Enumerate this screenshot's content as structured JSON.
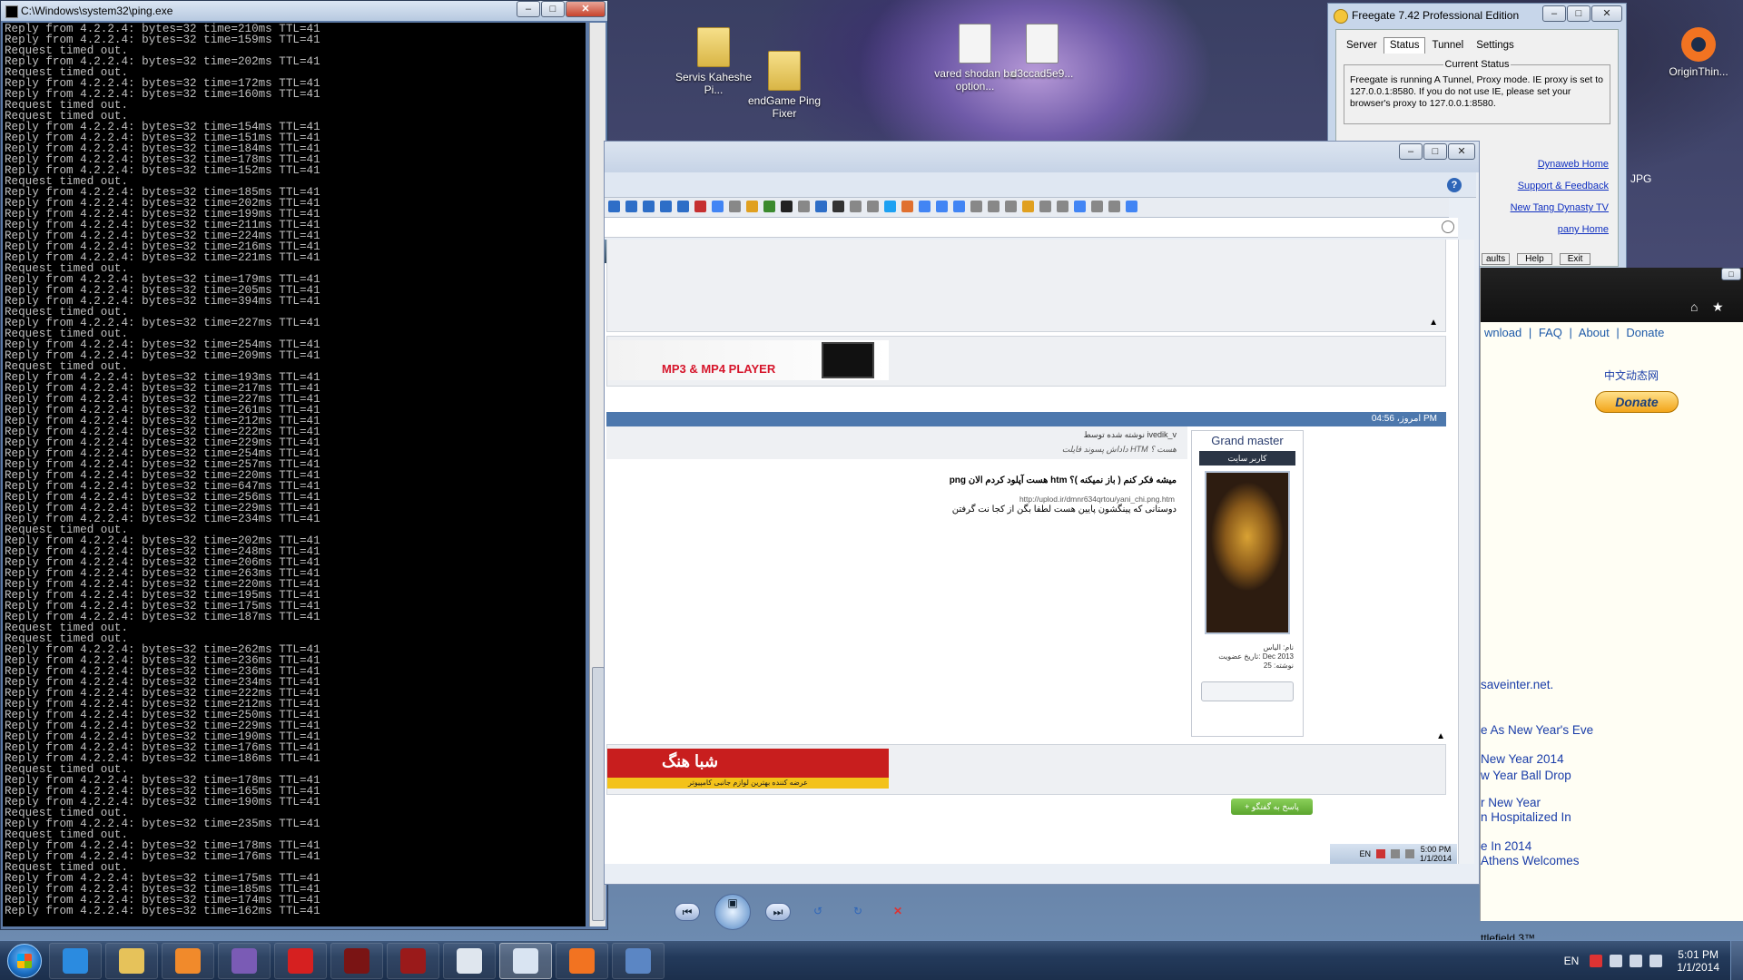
{
  "console": {
    "title": "C:\\Windows\\system32\\ping.exe",
    "lines": [
      "Reply from 4.2.2.4: bytes=32 time=210ms TTL=41",
      "Reply from 4.2.2.4: bytes=32 time=159ms TTL=41",
      "Request timed out.",
      "Reply from 4.2.2.4: bytes=32 time=202ms TTL=41",
      "Request timed out.",
      "Reply from 4.2.2.4: bytes=32 time=172ms TTL=41",
      "Reply from 4.2.2.4: bytes=32 time=160ms TTL=41",
      "Request timed out.",
      "Request timed out.",
      "Reply from 4.2.2.4: bytes=32 time=154ms TTL=41",
      "Reply from 4.2.2.4: bytes=32 time=151ms TTL=41",
      "Reply from 4.2.2.4: bytes=32 time=184ms TTL=41",
      "Reply from 4.2.2.4: bytes=32 time=178ms TTL=41",
      "Reply from 4.2.2.4: bytes=32 time=152ms TTL=41",
      "Request timed out.",
      "Reply from 4.2.2.4: bytes=32 time=185ms TTL=41",
      "Reply from 4.2.2.4: bytes=32 time=202ms TTL=41",
      "Reply from 4.2.2.4: bytes=32 time=199ms TTL=41",
      "Reply from 4.2.2.4: bytes=32 time=211ms TTL=41",
      "Reply from 4.2.2.4: bytes=32 time=224ms TTL=41",
      "Reply from 4.2.2.4: bytes=32 time=216ms TTL=41",
      "Reply from 4.2.2.4: bytes=32 time=221ms TTL=41",
      "Request timed out.",
      "Reply from 4.2.2.4: bytes=32 time=179ms TTL=41",
      "Reply from 4.2.2.4: bytes=32 time=205ms TTL=41",
      "Reply from 4.2.2.4: bytes=32 time=394ms TTL=41",
      "Request timed out.",
      "Reply from 4.2.2.4: bytes=32 time=227ms TTL=41",
      "Request timed out.",
      "Reply from 4.2.2.4: bytes=32 time=254ms TTL=41",
      "Reply from 4.2.2.4: bytes=32 time=209ms TTL=41",
      "Request timed out.",
      "Reply from 4.2.2.4: bytes=32 time=193ms TTL=41",
      "Reply from 4.2.2.4: bytes=32 time=217ms TTL=41",
      "Reply from 4.2.2.4: bytes=32 time=227ms TTL=41",
      "Reply from 4.2.2.4: bytes=32 time=261ms TTL=41",
      "Reply from 4.2.2.4: bytes=32 time=212ms TTL=41",
      "Reply from 4.2.2.4: bytes=32 time=222ms TTL=41",
      "Reply from 4.2.2.4: bytes=32 time=229ms TTL=41",
      "Reply from 4.2.2.4: bytes=32 time=254ms TTL=41",
      "Reply from 4.2.2.4: bytes=32 time=257ms TTL=41",
      "Reply from 4.2.2.4: bytes=32 time=220ms TTL=41",
      "Reply from 4.2.2.4: bytes=32 time=647ms TTL=41",
      "Reply from 4.2.2.4: bytes=32 time=256ms TTL=41",
      "Reply from 4.2.2.4: bytes=32 time=229ms TTL=41",
      "Reply from 4.2.2.4: bytes=32 time=234ms TTL=41",
      "Request timed out.",
      "Reply from 4.2.2.4: bytes=32 time=202ms TTL=41",
      "Reply from 4.2.2.4: bytes=32 time=248ms TTL=41",
      "Reply from 4.2.2.4: bytes=32 time=206ms TTL=41",
      "Reply from 4.2.2.4: bytes=32 time=263ms TTL=41",
      "Reply from 4.2.2.4: bytes=32 time=220ms TTL=41",
      "Reply from 4.2.2.4: bytes=32 time=195ms TTL=41",
      "Reply from 4.2.2.4: bytes=32 time=175ms TTL=41",
      "Reply from 4.2.2.4: bytes=32 time=187ms TTL=41",
      "Request timed out.",
      "Request timed out.",
      "Reply from 4.2.2.4: bytes=32 time=262ms TTL=41",
      "Reply from 4.2.2.4: bytes=32 time=236ms TTL=41",
      "Reply from 4.2.2.4: bytes=32 time=236ms TTL=41",
      "Reply from 4.2.2.4: bytes=32 time=234ms TTL=41",
      "Reply from 4.2.2.4: bytes=32 time=222ms TTL=41",
      "Reply from 4.2.2.4: bytes=32 time=212ms TTL=41",
      "Reply from 4.2.2.4: bytes=32 time=250ms TTL=41",
      "Reply from 4.2.2.4: bytes=32 time=229ms TTL=41",
      "Reply from 4.2.2.4: bytes=32 time=190ms TTL=41",
      "Reply from 4.2.2.4: bytes=32 time=176ms TTL=41",
      "Reply from 4.2.2.4: bytes=32 time=186ms TTL=41",
      "Request timed out.",
      "Reply from 4.2.2.4: bytes=32 time=178ms TTL=41",
      "Reply from 4.2.2.4: bytes=32 time=165ms TTL=41",
      "Reply from 4.2.2.4: bytes=32 time=190ms TTL=41",
      "Request timed out.",
      "Reply from 4.2.2.4: bytes=32 time=235ms TTL=41",
      "Request timed out.",
      "Reply from 4.2.2.4: bytes=32 time=178ms TTL=41",
      "Reply from 4.2.2.4: bytes=32 time=176ms TTL=41",
      "Request timed out.",
      "Reply from 4.2.2.4: bytes=32 time=175ms TTL=41",
      "Reply from 4.2.2.4: bytes=32 time=185ms TTL=41",
      "Reply from 4.2.2.4: bytes=32 time=174ms TTL=41",
      "Reply from 4.2.2.4: bytes=32 time=162ms TTL=41"
    ]
  },
  "desktop_icons": [
    {
      "label": "Servis Kaheshe Pi...",
      "icon": "folder-icon"
    },
    {
      "label": "endGame Ping Fixer",
      "icon": "folder-icon"
    },
    {
      "label": "vared shodan ba option...",
      "icon": "document-icon"
    },
    {
      "label": "d3ccad5e9...",
      "icon": "document-icon"
    },
    {
      "label": "OriginThin...",
      "icon": "origin-icon"
    }
  ],
  "freegate": {
    "title": "Freegate 7.42 Professional Edition",
    "tabs": [
      "Server",
      "Status",
      "Tunnel",
      "Settings"
    ],
    "active_tab": "Status",
    "status_legend": "Current Status",
    "status_text": "Freegate is running A Tunnel, Proxy mode. IE proxy is set to 127.0.0.1:8580. If you do not use IE, please set your browser's proxy to 127.0.0.1:8580.",
    "links": [
      "Dynaweb Home",
      "Support & Feedback",
      "New Tang Dynasty TV",
      "pany Home"
    ],
    "buttons": [
      "aults",
      "Help",
      "Exit"
    ]
  },
  "forum": {
    "timestamp_bar": "امروز، 04:56 PM",
    "ad_top_caption": "MP3 & MP4 PLAYER",
    "post_author_line": "نوشته شده توسط ivedik_v",
    "post_subtitle": "داداش پسوند فایلت HTM هست ؟",
    "post_text": "png هست آپلود کردم الان htm میشه فکر کنم ( باز نمیکنه )؟",
    "post_link": "http://uplod.ir/dmnr634qrtou/yani_chi.png.htm",
    "post_text2": "دوستانی که پینگشون پایین هست لطفا بگن از کجا نت گرفتن",
    "user_rank": "Grand master",
    "user_badge": "کاربر سایت",
    "user_meta": [
      "نام: الیاس",
      "تاریخ عضویت: Dec 2013",
      "نوشته: 25"
    ],
    "shop_ad_title": "شبا هنگ",
    "shop_ad_sub": "عرضه کننده بهترین لوازم جانبی کامپیوتر",
    "reply_button": "+ پاسخ به گفتگو",
    "inner_tray_lang": "EN",
    "inner_clock_time": "5:00 PM",
    "inner_clock_date": "1/1/2014"
  },
  "rightwin": {
    "nav": [
      "wnload",
      "|",
      "FAQ",
      "|",
      "About",
      "|",
      "Donate"
    ],
    "chinese_link": "中文动态网",
    "donate_label": "Donate",
    "headlines": [
      "saveinter.net.",
      "e As New Year's Eve",
      "New Year 2014",
      "w Year Ball Drop",
      "r New Year",
      "n Hospitalized In",
      "e In 2014",
      "Athens Welcomes"
    ],
    "bottom_item": "ttlefield 3™",
    "jpg_label": "JPG"
  },
  "taskbar": {
    "items": [
      {
        "name": "ie-icon",
        "color": "#2b8be0"
      },
      {
        "name": "explorer-icon",
        "color": "#e6c25a"
      },
      {
        "name": "media-player-icon",
        "color": "#f18a2b"
      },
      {
        "name": "visual-studio-icon",
        "color": "#7a5bb5"
      },
      {
        "name": "opera-icon",
        "color": "#d62020"
      },
      {
        "name": "gpu-tweak-icon",
        "color": "#7a1414"
      },
      {
        "name": "gpu-monitor-icon",
        "color": "#9a1a1a"
      },
      {
        "name": "window-icon",
        "color": "#dfe6ee"
      },
      {
        "name": "freegate-taskbar-icon",
        "color": "#d9e4f2"
      },
      {
        "name": "origin-taskbar-icon",
        "color": "#f27321"
      },
      {
        "name": "remote-icon",
        "color": "#5b86c4"
      }
    ],
    "lang": "EN",
    "time": "5:01 PM",
    "date": "1/1/2014"
  }
}
